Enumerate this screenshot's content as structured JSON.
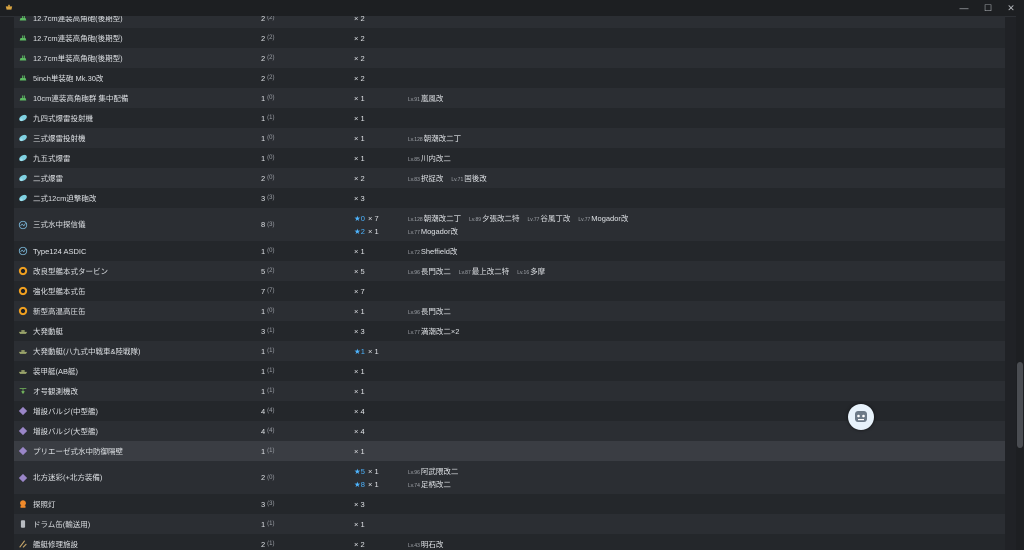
{
  "window": {
    "minimize": "—",
    "maximize": "☐",
    "close": "✕"
  },
  "rows": [
    {
      "icon": "gun",
      "name": "12.7cm連装高角砲(後期型)",
      "count": "2",
      "sub": "(2)",
      "mult": "× 2",
      "ships": []
    },
    {
      "icon": "gun",
      "name": "12.7cm連装高角砲(後期型)",
      "count": "2",
      "sub": "(2)",
      "mult": "× 2",
      "ships": []
    },
    {
      "icon": "gun",
      "name": "12.7cm単装高角砲(後期型)",
      "count": "2",
      "sub": "(2)",
      "mult": "× 2",
      "ships": []
    },
    {
      "icon": "gun",
      "name": "5inch単装砲 Mk.30改",
      "count": "2",
      "sub": "(2)",
      "mult": "× 2",
      "ships": []
    },
    {
      "icon": "gun",
      "name": "10cm連装高角砲群 集中配備",
      "count": "1",
      "sub": "(0)",
      "mult": "× 1",
      "ships": [
        {
          "lv": "Lv.91",
          "name": "嵐風改"
        }
      ]
    },
    {
      "icon": "asw",
      "name": "九四式爆雷投射機",
      "count": "1",
      "sub": "(1)",
      "mult": "× 1",
      "ships": []
    },
    {
      "icon": "asw",
      "name": "三式爆雷投射機",
      "count": "1",
      "sub": "(0)",
      "mult": "× 1",
      "ships": [
        {
          "lv": "Lv.128",
          "name": "朝潮改二丁"
        }
      ]
    },
    {
      "icon": "asw",
      "name": "九五式爆雷",
      "count": "1",
      "sub": "(0)",
      "mult": "× 1",
      "ships": [
        {
          "lv": "Lv.85",
          "name": "川内改二"
        }
      ]
    },
    {
      "icon": "asw",
      "name": "二式爆雷",
      "count": "2",
      "sub": "(0)",
      "mult": "× 2",
      "ships": [
        {
          "lv": "Lv.83",
          "name": "択捉改"
        },
        {
          "lv": "Lv.71",
          "name": "国後改"
        }
      ]
    },
    {
      "icon": "asw",
      "name": "二式12cm迫撃砲改",
      "count": "3",
      "sub": "(3)",
      "mult": "× 3",
      "ships": []
    },
    {
      "icon": "sonar",
      "name": "三式水中探信儀",
      "count": "8",
      "sub": "(3)",
      "tall": true,
      "lines": [
        {
          "star": "★0",
          "mult": "× 7",
          "ships": [
            {
              "lv": "Lv.128",
              "name": "朝潮改二丁"
            },
            {
              "lv": "Lv.89",
              "name": "夕張改二特"
            },
            {
              "lv": "Lv.77",
              "name": "谷風丁改"
            },
            {
              "lv": "Lv.77",
              "name": "Mogador改"
            }
          ]
        },
        {
          "star": "★2",
          "mult": "× 1",
          "ships": [
            {
              "lv": "Lv.77",
              "name": "Mogador改"
            }
          ]
        }
      ]
    },
    {
      "icon": "sonar",
      "name": "Type124 ASDIC",
      "count": "1",
      "sub": "(0)",
      "mult": "× 1",
      "ships": [
        {
          "lv": "Lv.72",
          "name": "Sheffield改"
        }
      ]
    },
    {
      "icon": "turbine",
      "name": "改良型艦本式タービン",
      "count": "5",
      "sub": "(2)",
      "mult": "× 5",
      "ships": [
        {
          "lv": "Lv.96",
          "name": "長門改二"
        },
        {
          "lv": "Lv.87",
          "name": "最上改二特"
        },
        {
          "lv": "Lv.16",
          "name": "多摩"
        }
      ]
    },
    {
      "icon": "turbine",
      "name": "強化型艦本式缶",
      "count": "7",
      "sub": "(7)",
      "mult": "× 7",
      "ships": []
    },
    {
      "icon": "turbine",
      "name": "新型高温高圧缶",
      "count": "1",
      "sub": "(0)",
      "mult": "× 1",
      "ships": [
        {
          "lv": "Lv.96",
          "name": "長門改二"
        }
      ]
    },
    {
      "icon": "landing",
      "name": "大発動艇",
      "count": "3",
      "sub": "(1)",
      "mult": "× 3",
      "ships": [
        {
          "lv": "Lv.77",
          "name": "満潮改二×2"
        }
      ]
    },
    {
      "icon": "landing",
      "name": "大発動艇(八九式中戦車&陸戦隊)",
      "count": "1",
      "sub": "(1)",
      "star": "★1",
      "mult": "× 1",
      "ships": []
    },
    {
      "icon": "landing",
      "name": "装甲艇(AB艇)",
      "count": "1",
      "sub": "(1)",
      "mult": "× 1",
      "ships": []
    },
    {
      "icon": "autogyro",
      "name": "オ号観測機改",
      "count": "1",
      "sub": "(1)",
      "mult": "× 1",
      "ships": []
    },
    {
      "icon": "bulge",
      "name": "増設バルジ(中型艦)",
      "count": "4",
      "sub": "(4)",
      "mult": "× 4",
      "ships": []
    },
    {
      "icon": "bulge",
      "name": "増設バルジ(大型艦)",
      "count": "4",
      "sub": "(4)",
      "mult": "× 4",
      "ships": []
    },
    {
      "icon": "bulge",
      "name": "プリエーゼ式水中防御隔壁",
      "count": "1",
      "sub": "(1)",
      "mult": "× 1",
      "ships": [],
      "highlight": true
    },
    {
      "icon": "bulge",
      "name": "北方迷彩(+北方装備)",
      "count": "2",
      "sub": "(0)",
      "tall": true,
      "lines": [
        {
          "star": "★5",
          "mult": "× 1",
          "ships": [
            {
              "lv": "Lv.96",
              "name": "阿武隈改二"
            }
          ]
        },
        {
          "star": "★8",
          "mult": "× 1",
          "ships": [
            {
              "lv": "Lv.74",
              "name": "足柄改二"
            }
          ]
        }
      ]
    },
    {
      "icon": "searchlight",
      "name": "探照灯",
      "count": "3",
      "sub": "(3)",
      "mult": "× 3",
      "ships": []
    },
    {
      "icon": "drum",
      "name": "ドラム缶(輸送用)",
      "count": "1",
      "sub": "(1)",
      "mult": "× 1",
      "ships": []
    },
    {
      "icon": "repair",
      "name": "艦艇修理施設",
      "count": "2",
      "sub": "(1)",
      "mult": "× 2",
      "ships": [
        {
          "lv": "Lv.43",
          "name": "明石改"
        }
      ]
    }
  ],
  "colors": {
    "gun": "#5dbb63",
    "asw": "#7ed0e0",
    "sonar": "#7ab6d8",
    "turbine": "#f0a020",
    "landing": "#9aa46a",
    "autogyro": "#6fae5a",
    "bulge": "#9a86c8",
    "searchlight": "#f08a2a",
    "drum": "#b8bcc2",
    "repair": "#c9a86a",
    "star": "#4db4ff"
  }
}
